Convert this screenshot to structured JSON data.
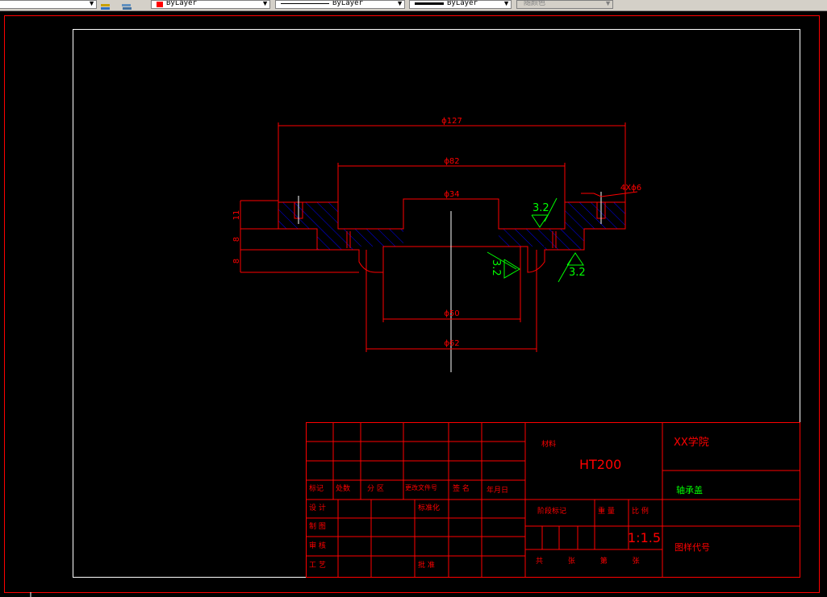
{
  "toolbar": {
    "color_value": "ByLayer",
    "linetype_value": "ByLayer",
    "lineweight_value": "ByLayer",
    "plotstyle_value": "随颜色",
    "color_swatch": "#ff0000"
  },
  "drawing": {
    "colors": {
      "outline": "#ff0000",
      "hatch": "#0000ff",
      "roughness": "#00ff00",
      "background": "#000000"
    },
    "dims": {
      "d127": "ϕ127",
      "d82": "ϕ82",
      "d34": "ϕ34",
      "d50": "ϕ50",
      "d62": "ϕ62",
      "holes": "4Xϕ6",
      "h11": "11",
      "h8a": "8",
      "h8b": "8"
    },
    "roughness": {
      "r1": "3.2",
      "r2": "3.2",
      "r3": "3.2"
    }
  },
  "title_block": {
    "material_label": "材料",
    "material_value": "HT200",
    "school": "XX学院",
    "part_name": "轴承盖",
    "drawing_code_label": "图样代号",
    "scale_value": "1:1.5",
    "row_labels": {
      "mark": "标记",
      "count": "处数",
      "zone": "分 区",
      "change_doc": "更改文件号",
      "sign": "签 名",
      "date": "年月日"
    },
    "sig_labels": {
      "design": "设 计",
      "drafting": "制 图",
      "review": "审 核",
      "process": "工 艺",
      "standardize": "标准化",
      "approve": "批 准"
    },
    "stage_labels": {
      "stage_mark": "阶段标记",
      "weight": "重 量",
      "scale": "比 例"
    },
    "sheets_label": "共 张 第 张"
  }
}
